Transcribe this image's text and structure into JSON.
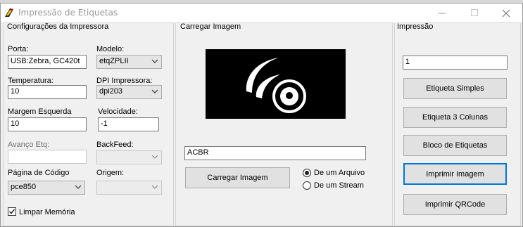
{
  "window": {
    "title": "Impressão de Etiquetas",
    "minimize_icon": "minimize-icon",
    "maximize_icon": "maximize-icon",
    "close_icon": "close-icon"
  },
  "printer_config": {
    "title": "Configurações da Impressora",
    "porta_label": "Porta:",
    "porta_value": "USB:Zebra, GC420t",
    "modelo_label": "Modelo:",
    "modelo_value": "etqZPLII",
    "temperatura_label": "Temperatura:",
    "temperatura_value": "10",
    "dpi_label": "DPI Impressora:",
    "dpi_value": "dpi203",
    "margem_label": "Margem Esquerda",
    "margem_value": "10",
    "velocidade_label": "Velocidade:",
    "velocidade_value": "-1",
    "avanco_label": "Avanço Etq:",
    "avanco_value": "",
    "backfeed_label": "BackFeed:",
    "backfeed_value": "",
    "pagina_label": "Página de Código",
    "pagina_value": "pce850",
    "origem_label": "Origem:",
    "origem_value": "",
    "limpar_label": "Limpar Memória",
    "limpar_checked": true
  },
  "load_image": {
    "title": "Carregar Imagem",
    "name_value": "ACBR",
    "load_button": "Carregar Imagem",
    "from_file_label": "De um Arquivo",
    "from_stream_label": "De um Stream",
    "selected_source": "De um Arquivo"
  },
  "print": {
    "title": "Impressão",
    "copies_value": "1",
    "btn_simple": "Etiqueta Simples",
    "btn_three_cols": "Etiqueta 3 Colunas",
    "btn_block": "Bloco de Etiquetas",
    "btn_image": "Imprimir Imagem",
    "btn_qrcode": "Imprimir QRCode"
  },
  "colors": {
    "window_bg": "#f0f0f0",
    "focus_border": "#0078d7",
    "title_text": "#9a9a9a"
  }
}
